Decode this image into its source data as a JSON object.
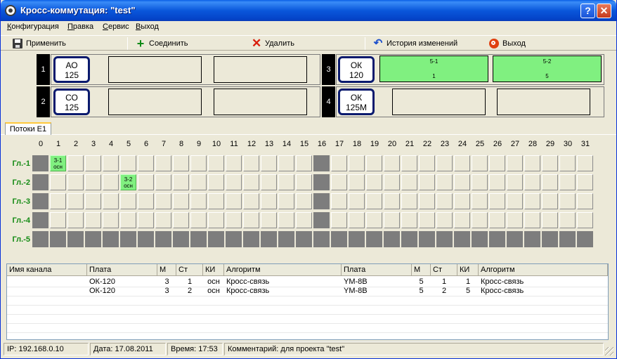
{
  "window": {
    "title": "Кросс-коммутация: \"test\""
  },
  "menu": [
    "Конфигурация",
    "Правка",
    "Сервис",
    "Выход"
  ],
  "toolbar": {
    "apply": "Применить",
    "connect": "Соединить",
    "delete": "Удалить",
    "history": "История изменений",
    "exit": "Выход"
  },
  "slots": [
    {
      "num": "1",
      "card_line1": "АО",
      "card_line2": "125",
      "ports": [
        {
          "top": "",
          "bottom": "",
          "active": false
        },
        {
          "top": "",
          "bottom": "",
          "active": false
        }
      ]
    },
    {
      "num": "2",
      "card_line1": "СО",
      "card_line2": "125",
      "ports": [
        {
          "top": "",
          "bottom": "",
          "active": false
        },
        {
          "top": "",
          "bottom": "",
          "active": false
        }
      ]
    },
    {
      "num": "3",
      "card_line1": "ОК",
      "card_line2": "120",
      "ports": [
        {
          "top": "5-1",
          "bottom": "1",
          "active": true
        },
        {
          "top": "5-2",
          "bottom": "5",
          "active": true
        }
      ]
    },
    {
      "num": "4",
      "card_line1": "ОК",
      "card_line2": "125М",
      "ports": [
        {
          "top": "",
          "bottom": "",
          "active": false
        },
        {
          "top": "",
          "bottom": "",
          "active": false
        }
      ]
    }
  ],
  "tab": {
    "label": "Потоки Е1"
  },
  "grid": {
    "columns": [
      "0",
      "1",
      "2",
      "3",
      "4",
      "5",
      "6",
      "7",
      "8",
      "9",
      "10",
      "11",
      "12",
      "13",
      "14",
      "15",
      "16",
      "17",
      "18",
      "19",
      "20",
      "21",
      "22",
      "23",
      "24",
      "25",
      "26",
      "27",
      "28",
      "29",
      "30",
      "31"
    ],
    "rows": [
      "Гл.-1",
      "Гл.-2",
      "Гл.-3",
      "Гл.-4",
      "Гл.-5"
    ],
    "highlights": [
      {
        "row": 0,
        "col": 1,
        "line1": "3-1",
        "line2": "осн"
      },
      {
        "row": 1,
        "col": 5,
        "line1": "3-2",
        "line2": "осн"
      }
    ]
  },
  "table": {
    "headers": [
      "Имя канала",
      "Плата",
      "М",
      "Ст",
      "КИ",
      "Алгоритм",
      "Плата",
      "М",
      "Ст",
      "КИ",
      "Алгоритм"
    ],
    "rows": [
      [
        "",
        "ОК-120",
        "3",
        "1",
        "осн",
        "Кросс-связь",
        "YM-8B",
        "5",
        "1",
        "1",
        "Кросс-связь"
      ],
      [
        "",
        "ОК-120",
        "3",
        "2",
        "осн",
        "Кросс-связь",
        "YM-8B",
        "5",
        "2",
        "5",
        "Кросс-связь"
      ]
    ]
  },
  "status": {
    "ip": "IP: 192.168.0.10",
    "date": "Дата: 17.08.2011",
    "time": "Время: 17:53",
    "comment": "Комментарий: для проекта \"test\""
  }
}
